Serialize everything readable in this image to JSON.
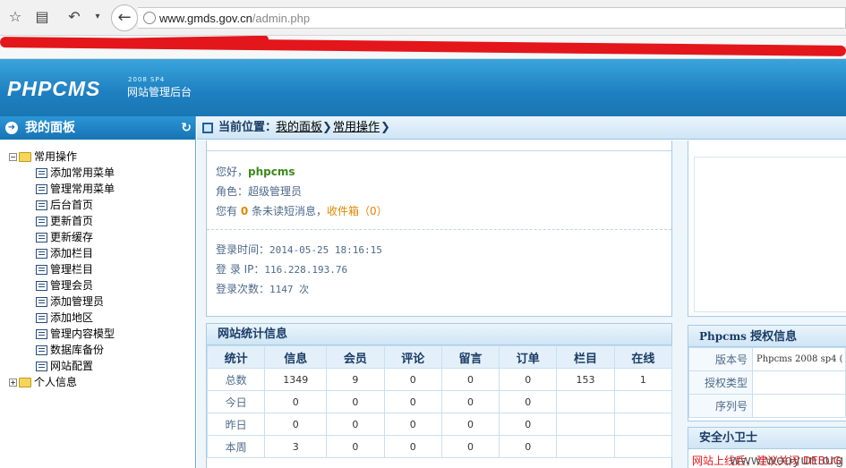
{
  "browser": {
    "url_host": "www.gmds.gov.cn",
    "url_path": "/admin.php"
  },
  "header": {
    "logo": "PHPCMS",
    "version": "2008 SP4",
    "subtitle": "网站管理后台"
  },
  "sidebar": {
    "title": "我的面板",
    "group1": "常用操作",
    "items": [
      "添加常用菜单",
      "管理常用菜单",
      "后台首页",
      "更新首页",
      "更新缓存",
      "添加栏目",
      "管理栏目",
      "管理会员",
      "添加管理员",
      "添加地区",
      "管理内容模型",
      "数据库备份",
      "网站配置"
    ],
    "group2": "个人信息"
  },
  "breadcrumb": {
    "label": "当前位置：",
    "link1": "我的面板",
    "link2": "常用操作",
    "sep": "❯"
  },
  "personal": {
    "hello_prefix": "您好，",
    "username": "phpcms",
    "role_label": "角色：",
    "role": "超级管理员",
    "msg_pre": "您有 ",
    "msg_count": "0",
    "msg_mid": " 条未读短消息，",
    "inbox": "收件箱",
    "inbox_count": "（0）",
    "login_time_label": "登录时间：",
    "login_time": "2014-05-25 18:16:15",
    "login_ip_label": "登 录 IP：",
    "login_ip": "116.228.193.76",
    "login_count_label": "登录次数：",
    "login_count": "1147 次"
  },
  "stats": {
    "title": "网站统计信息",
    "headers": [
      "统计",
      "信息",
      "会员",
      "评论",
      "留言",
      "订单",
      "栏目",
      "在线"
    ],
    "rows": [
      [
        "总数",
        "1349",
        "9",
        "0",
        "0",
        "0",
        "153",
        "1"
      ],
      [
        "今日",
        "0",
        "0",
        "0",
        "0",
        "0",
        "",
        ""
      ],
      [
        "昨日",
        "0",
        "0",
        "0",
        "0",
        "0",
        "",
        ""
      ],
      [
        "本周",
        "3",
        "0",
        "0",
        "0",
        "0",
        "",
        ""
      ]
    ]
  },
  "license": {
    "title_brand": "Phpcms",
    "title": "授权信息",
    "version_label": "版本号",
    "version_value": "Phpcms 2008 sp4 (",
    "type_label": "授权类型",
    "serial_label": "序列号"
  },
  "guard": {
    "title": "安全小卫士",
    "warning": "网站上线后，建议关闭 DEBUG"
  },
  "watermark": "www.wooyun.org",
  "colors": {
    "header_blue": "#1e7fc0",
    "accent_green": "#3c8a1c",
    "accent_orange": "#e08800",
    "warning_red": "#e3161b"
  }
}
